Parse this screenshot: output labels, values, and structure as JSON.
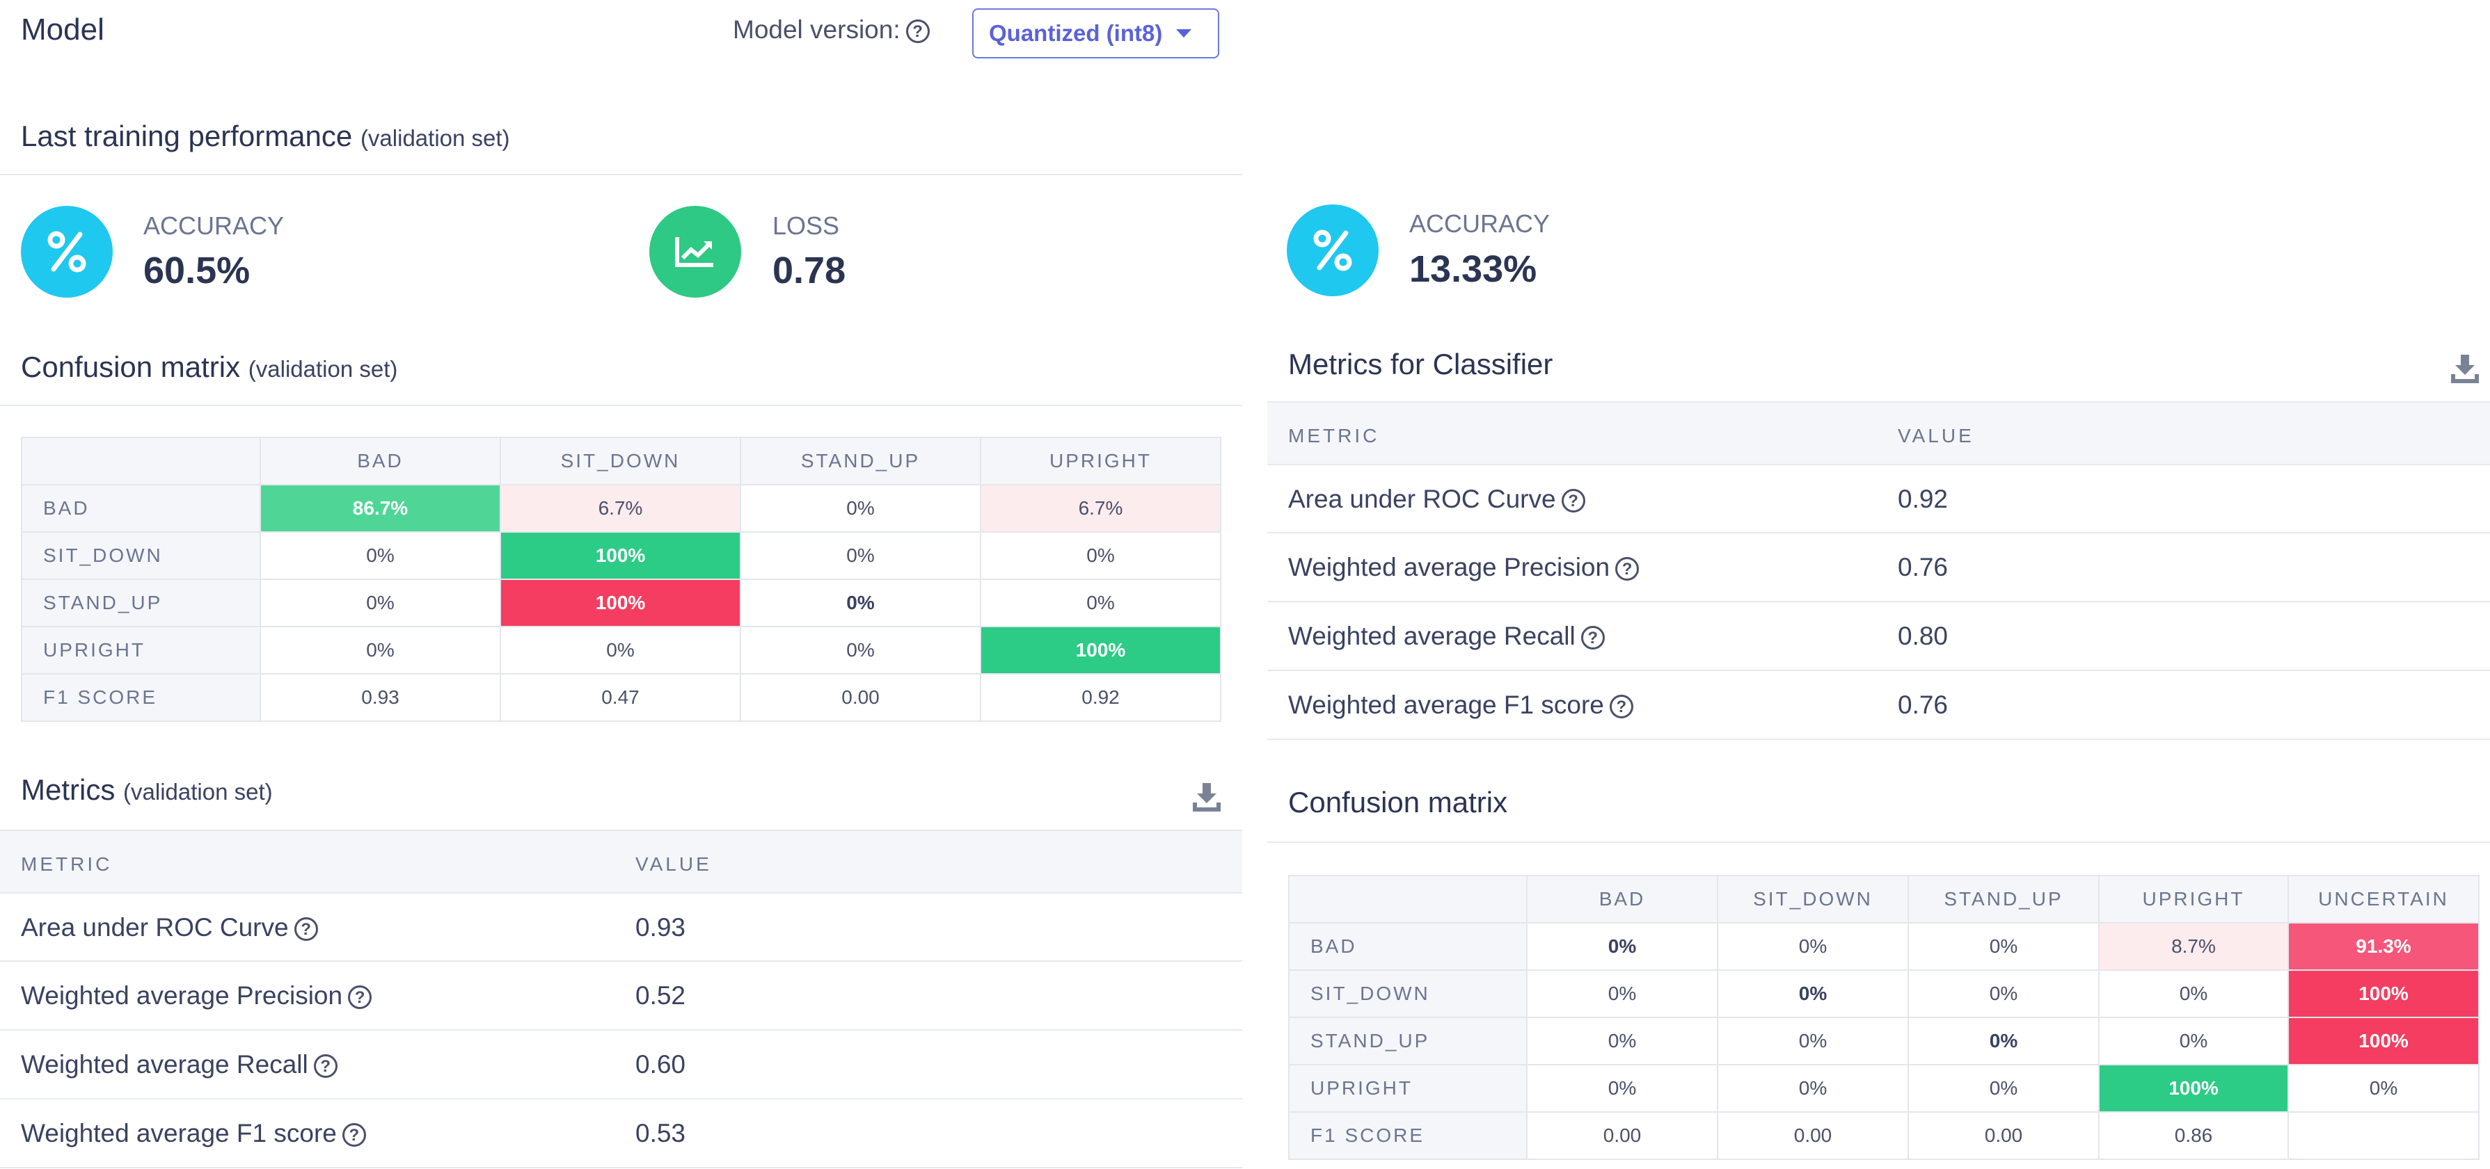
{
  "header": {
    "title": "Model",
    "version_label": "Model version:",
    "version_value": "Quantized (int8)"
  },
  "training": {
    "title": "Last training performance",
    "subtitle": "(validation set)",
    "accuracy_label": "ACCURACY",
    "accuracy_value": "60.5%",
    "loss_label": "LOSS",
    "loss_value": "0.78"
  },
  "confusion_left": {
    "title": "Confusion matrix",
    "subtitle": "(validation set)",
    "columns": [
      "BAD",
      "SIT_DOWN",
      "STAND_UP",
      "UPRIGHT"
    ],
    "rows": [
      {
        "label": "BAD",
        "cells": [
          "86.7%",
          "6.7%",
          "0%",
          "6.7%"
        ]
      },
      {
        "label": "SIT_DOWN",
        "cells": [
          "0%",
          "100%",
          "0%",
          "0%"
        ]
      },
      {
        "label": "STAND_UP",
        "cells": [
          "0%",
          "100%",
          "0%",
          "0%"
        ]
      },
      {
        "label": "UPRIGHT",
        "cells": [
          "0%",
          "0%",
          "0%",
          "100%"
        ]
      },
      {
        "label": "F1 SCORE",
        "cells": [
          "0.93",
          "0.47",
          "0.00",
          "0.92"
        ]
      }
    ]
  },
  "metrics_left": {
    "title": "Metrics",
    "subtitle": "(validation set)",
    "col_metric": "METRIC",
    "col_value": "VALUE",
    "rows": [
      {
        "name": "Area under ROC Curve",
        "value": "0.93"
      },
      {
        "name": "Weighted average Precision",
        "value": "0.52"
      },
      {
        "name": "Weighted average Recall",
        "value": "0.60"
      },
      {
        "name": "Weighted average F1 score",
        "value": "0.53"
      }
    ]
  },
  "test": {
    "accuracy_label": "ACCURACY",
    "accuracy_value": "13.33%"
  },
  "metrics_right": {
    "title": "Metrics for Classifier",
    "col_metric": "METRIC",
    "col_value": "VALUE",
    "rows": [
      {
        "name": "Area under ROC Curve",
        "value": "0.92"
      },
      {
        "name": "Weighted average Precision",
        "value": "0.76"
      },
      {
        "name": "Weighted average Recall",
        "value": "0.80"
      },
      {
        "name": "Weighted average F1 score",
        "value": "0.76"
      }
    ]
  },
  "confusion_right": {
    "title": "Confusion matrix",
    "columns": [
      "BAD",
      "SIT_DOWN",
      "STAND_UP",
      "UPRIGHT",
      "UNCERTAIN"
    ],
    "rows": [
      {
        "label": "BAD",
        "cells": [
          "0%",
          "0%",
          "0%",
          "8.7%",
          "91.3%"
        ]
      },
      {
        "label": "SIT_DOWN",
        "cells": [
          "0%",
          "0%",
          "0%",
          "0%",
          "100%"
        ]
      },
      {
        "label": "STAND_UP",
        "cells": [
          "0%",
          "0%",
          "0%",
          "0%",
          "100%"
        ]
      },
      {
        "label": "UPRIGHT",
        "cells": [
          "0%",
          "0%",
          "0%",
          "100%",
          "0%"
        ]
      },
      {
        "label": "F1 SCORE",
        "cells": [
          "0.00",
          "0.00",
          "0.00",
          "0.86",
          ""
        ]
      }
    ]
  },
  "icons": {
    "percent": "percent-icon",
    "chart": "trend-chart-icon",
    "help": "help-circle-icon",
    "download": "download-icon",
    "caret": "chevron-down-icon"
  },
  "colors": {
    "accent": "#5b62d8",
    "blue_circle": "#1fc8ee",
    "green_circle": "#2ec984",
    "cell_good": "#2ccb86",
    "cell_bad": "#f43d60"
  }
}
